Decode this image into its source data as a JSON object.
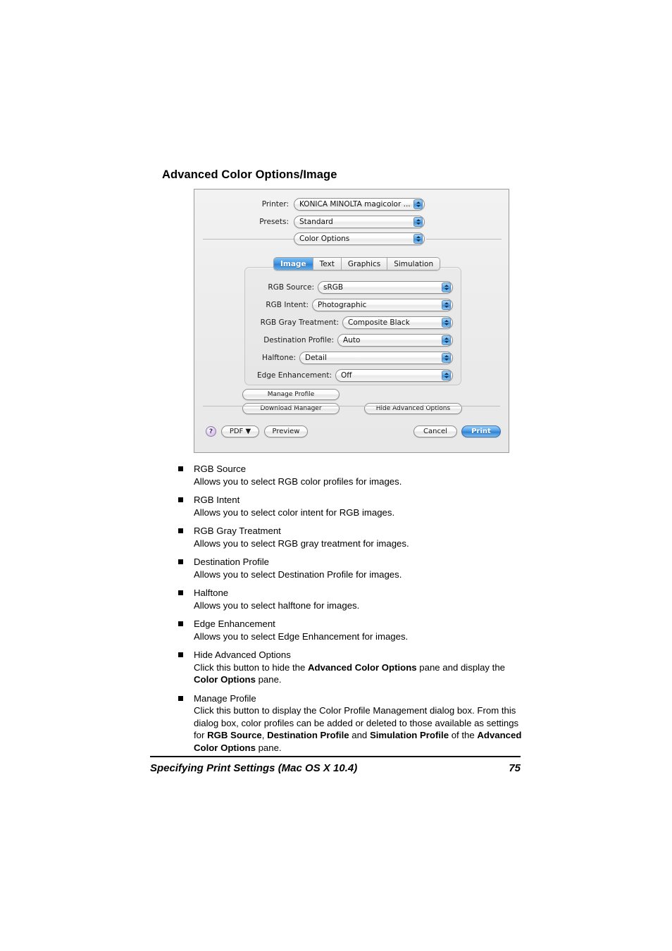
{
  "page": {
    "title": "Advanced Color Options/Image",
    "footer_title": "Specifying Print Settings (Mac OS X 10.4)",
    "footer_page_number": "75"
  },
  "dialog": {
    "printer": {
      "label": "Printer:",
      "value": "KONICA MINOLTA magicolor ..."
    },
    "presets": {
      "label": "Presets:",
      "value": "Standard"
    },
    "pane_selector": {
      "value": "Color Options"
    },
    "tabs": [
      {
        "label": "Image",
        "selected": true
      },
      {
        "label": "Text",
        "selected": false
      },
      {
        "label": "Graphics",
        "selected": false
      },
      {
        "label": "Simulation",
        "selected": false
      }
    ],
    "fields": [
      {
        "label": "RGB Source:",
        "value": "sRGB"
      },
      {
        "label": "RGB Intent:",
        "value": "Photographic"
      },
      {
        "label": "RGB Gray Treatment:",
        "value": "Composite Black"
      },
      {
        "label": "Destination Profile:",
        "value": "Auto"
      },
      {
        "label": "Halftone:",
        "value": "Detail"
      },
      {
        "label": "Edge Enhancement:",
        "value": "Off"
      }
    ],
    "buttons": {
      "manage_profile": "Manage Profile",
      "download_manager": "Download Manager",
      "hide_advanced_options": "Hide Advanced Options",
      "help": "?",
      "pdf": "PDF ▼",
      "preview": "Preview",
      "cancel": "Cancel",
      "print": "Print"
    },
    "accent_color": "#3f93e0",
    "help_color": "#c8b0e0"
  },
  "bullets": [
    {
      "term": "RGB Source",
      "desc_html": "Allows you to select RGB color profiles for images."
    },
    {
      "term": "RGB Intent",
      "desc_html": "Allows you to select color intent for RGB images."
    },
    {
      "term": "RGB Gray Treatment",
      "desc_html": "Allows you to select RGB gray treatment for images."
    },
    {
      "term": "Destination Profile",
      "desc_html": "Allows you to select Destination Profile for images."
    },
    {
      "term": "Halftone",
      "desc_html": "Allows you to select halftone for images."
    },
    {
      "term": "Edge Enhancement",
      "desc_html": "Allows you to select Edge Enhancement for images."
    },
    {
      "term": "Hide Advanced Options",
      "desc_html": "Click this button to hide the <b>Advanced Color Options</b> pane and display the <b>Color Options</b> pane."
    },
    {
      "term": "Manage Profile",
      "desc_html": "Click this button to display the Color Profile Management dialog box. From this dialog box, color profiles can be added or deleted to those available as settings for <b>RGB Source</b>, <b>Destination Profile</b> and <b>Simulation Profile</b> of the <b>Advanced Color Options</b> pane."
    }
  ]
}
